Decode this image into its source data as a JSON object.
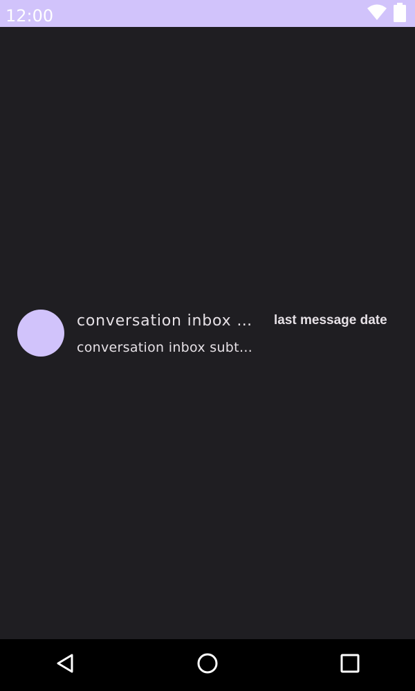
{
  "status_bar": {
    "time": "12:00",
    "icons": [
      "wifi-icon",
      "battery-icon"
    ],
    "background": "#d1c3fb"
  },
  "inbox": {
    "conversations": [
      {
        "title": "conversation inbox title",
        "subtitle": "conversation inbox subtitle",
        "date": "last message date",
        "avatar_color": "#d1c3fb"
      }
    ]
  },
  "nav_bar": {
    "buttons": [
      "back-icon",
      "home-icon",
      "recents-icon"
    ]
  },
  "colors": {
    "background": "#1f1e22",
    "accent": "#d1c3fb",
    "text": "#e6e1e6"
  }
}
